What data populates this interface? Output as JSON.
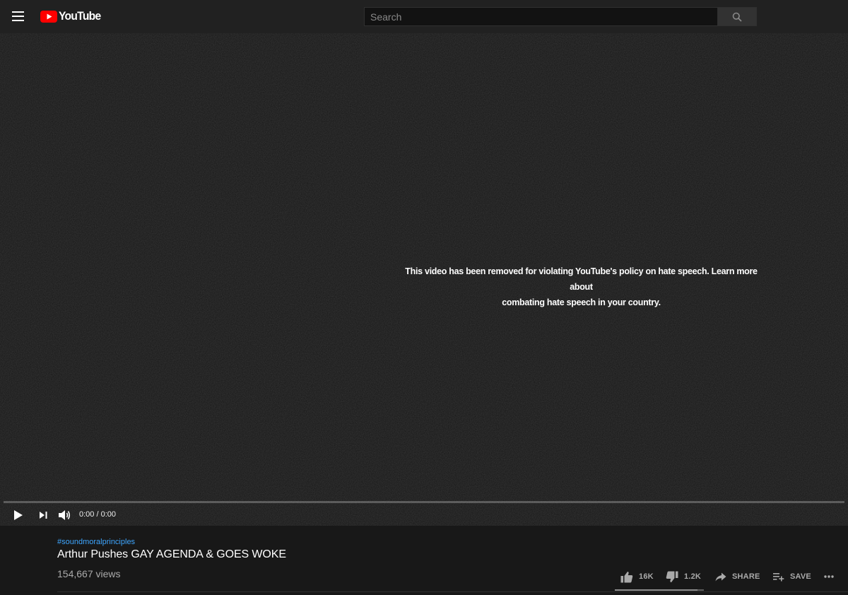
{
  "header": {
    "logo_text": "YouTube",
    "search_placeholder": "Search"
  },
  "player": {
    "message_line1": "This video has been removed for violating YouTube's policy on hate speech. Learn more about",
    "message_line2": "combating hate speech in your country.",
    "time": "0:00 / 0:00",
    "progress_fraction": 0
  },
  "video": {
    "hashtag": "#soundmoralprinciples",
    "title": "Arthur Pushes GAY AGENDA & GOES WOKE",
    "views": "154,667 views",
    "likes": "16K",
    "dislikes": "1.2K",
    "like_ratio": 0.93,
    "share_label": "SHARE",
    "save_label": "SAVE"
  },
  "colors": {
    "brand_red": "#ff0000",
    "link_blue": "#3ea6ff",
    "background": "#181818",
    "topbar": "#212121"
  },
  "icons": [
    "menu-icon",
    "youtube-logo-icon",
    "search-icon",
    "play-icon",
    "next-icon",
    "volume-icon",
    "thumbs-up-icon",
    "thumbs-down-icon",
    "share-icon",
    "playlist-add-icon",
    "more-icon"
  ]
}
